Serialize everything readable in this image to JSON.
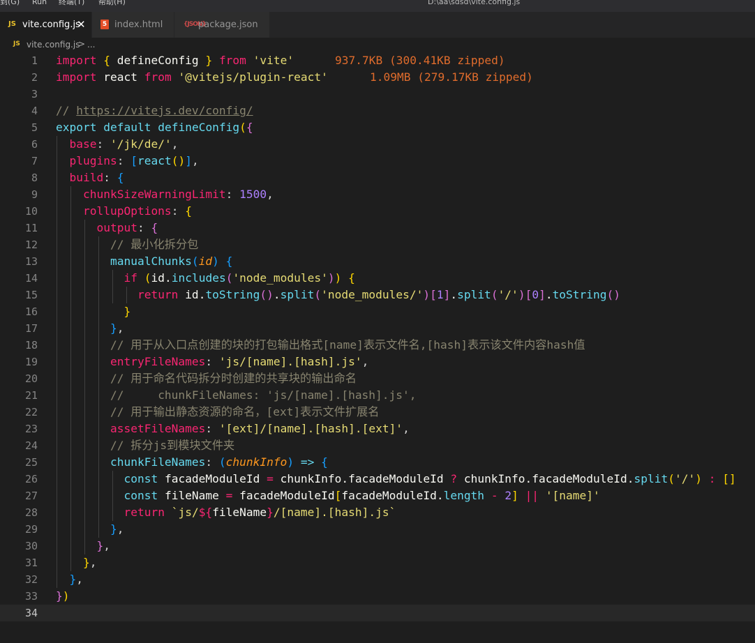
{
  "menu": {
    "items": [
      "到(G)",
      "Run",
      "终端(T)",
      "帮助(H)"
    ],
    "window_title": "D:\\aa\\sdsd\\vite.config.js"
  },
  "tabs": [
    {
      "icon": "JS",
      "label": "vite.config.js",
      "active": true,
      "close": "✕"
    },
    {
      "icon": "5",
      "label": "index.html",
      "active": false
    },
    {
      "icon": "{JSON}",
      "label": "package.json",
      "active": false
    }
  ],
  "breadcrumb": {
    "icon": "JS",
    "file": "vite.config.js",
    "separator": ">",
    "more": "..."
  },
  "editor": {
    "current_line": 34,
    "line_numbers": [
      "1",
      "2",
      "3",
      "4",
      "5",
      "6",
      "7",
      "8",
      "9",
      "10",
      "11",
      "12",
      "13",
      "14",
      "15",
      "16",
      "17",
      "18",
      "19",
      "20",
      "21",
      "22",
      "23",
      "24",
      "25",
      "26",
      "27",
      "28",
      "29",
      "30",
      "31",
      "32",
      "33",
      "34"
    ],
    "import_cost": [
      "937.7KB (300.41KB zipped)",
      "1.09MB (279.17KB zipped)"
    ],
    "lines": [
      [
        "import",
        " ",
        "{",
        " defineConfig ",
        "}",
        " ",
        "from",
        " ",
        "'vite'"
      ],
      [
        "import",
        " react ",
        "from",
        " ",
        "'@vitejs/plugin-react'"
      ],
      [],
      [
        "// ",
        "https://vitejs.dev/config/"
      ],
      [
        "export",
        " ",
        "default",
        " ",
        "defineConfig",
        "(",
        "{"
      ],
      [
        "  ",
        "base",
        ": ",
        "'/jk/de/'",
        ","
      ],
      [
        "  ",
        "plugins",
        ": ",
        "[",
        "react",
        "()",
        "]",
        ","
      ],
      [
        "  ",
        "build",
        ": ",
        "{"
      ],
      [
        "    ",
        "chunkSizeWarningLimit",
        ": ",
        "1500",
        ","
      ],
      [
        "    ",
        "rollupOptions",
        ": ",
        "{"
      ],
      [
        "      ",
        "output",
        ": ",
        "{"
      ],
      [
        "        ",
        "// 最小化拆分包"
      ],
      [
        "        ",
        "manualChunks",
        "(",
        "id",
        ") ",
        "{"
      ],
      [
        "          ",
        "if",
        " ",
        "(",
        "id",
        ".",
        "includes",
        "(",
        "'node_modules'",
        ")",
        ")",
        " ",
        "{"
      ],
      [
        "            ",
        "return",
        " ",
        "id",
        ".",
        "toString",
        "()",
        ".",
        "split",
        "(",
        "'node_modules/'",
        ")",
        "[",
        "1",
        "]",
        ".",
        "split",
        "(",
        "'/'",
        ")",
        "[",
        "0",
        "]",
        ".",
        "toString",
        "()"
      ],
      [
        "          ",
        "}"
      ],
      [
        "        ",
        "}",
        ","
      ],
      [
        "        ",
        "// 用于从入口点创建的块的打包输出格式[name]表示文件名,[hash]表示该文件内容hash值"
      ],
      [
        "        ",
        "entryFileNames",
        ": ",
        "'js/[name].[hash].js'",
        ","
      ],
      [
        "        ",
        "// 用于命名代码拆分时创建的共享块的输出命名"
      ],
      [
        "        ",
        "//     chunkFileNames: 'js/[name].[hash].js',"
      ],
      [
        "        ",
        "// 用于输出静态资源的命名，[ext]表示文件扩展名"
      ],
      [
        "        ",
        "assetFileNames",
        ": ",
        "'[ext]/[name].[hash].[ext]'",
        ","
      ],
      [
        "        ",
        "// 拆分js到模块文件夹"
      ],
      [
        "        ",
        "chunkFileNames",
        ": ",
        "(",
        "chunkInfo",
        ") ",
        "=>",
        " ",
        "{"
      ],
      [
        "          ",
        "const",
        " ",
        "facadeModuleId",
        " ",
        "=",
        " ",
        "chunkInfo",
        ".",
        "facadeModuleId",
        " ",
        "?",
        " ",
        "chunkInfo",
        ".",
        "facadeModuleId",
        ".",
        "split",
        "(",
        "'/'",
        ")",
        " ",
        ":",
        " ",
        "[]"
      ],
      [
        "          ",
        "const",
        " ",
        "fileName",
        " ",
        "=",
        " ",
        "facadeModuleId",
        "[",
        "facadeModuleId",
        ".",
        "length",
        " ",
        "-",
        " ",
        "2",
        "]",
        " ",
        "||",
        " ",
        "'[name]'"
      ],
      [
        "          ",
        "return",
        " ",
        "`js/",
        "${",
        "fileName",
        "}",
        "/[name].[hash].js`"
      ],
      [
        "        ",
        "}",
        ","
      ],
      [
        "      ",
        "}",
        ","
      ],
      [
        "    ",
        "}",
        ","
      ],
      [
        "  ",
        "}",
        ","
      ],
      [
        "}",
        ")"
      ],
      []
    ]
  },
  "colors": {
    "keyword": "#f92672",
    "function": "#a6e22e",
    "string": "#e6db74",
    "number": "#ae81ff",
    "comment": "#88846f",
    "import_cost": "#e06c2c",
    "background": "#1e1e1e"
  }
}
